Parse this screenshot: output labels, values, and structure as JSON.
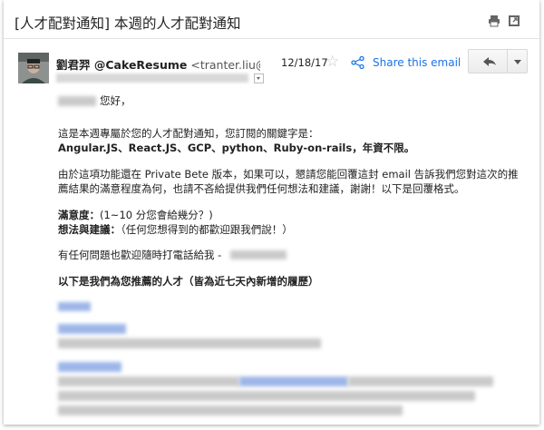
{
  "email": {
    "subject": "[人才配對通知] 本週的人才配對通知",
    "sender_name": "劉君羿 @CakeResume",
    "sender_email": "<tranter.liu@caker",
    "date": "12/18/17",
    "share_label": "Share this email"
  },
  "body": {
    "greeting": "您好，",
    "line1": "這是本週專屬於您的人才配對通知，您訂閱的關鍵字是：",
    "keywords": "Angular.JS、React.JS、GCP、python、Ruby-on-rails，年資不限。",
    "para2_line1": "由於這項功能還在 Private Bete 版本，如果可以，懇請您能回覆這封 email 告訴我們您對這次的推",
    "para2_line2": "薦結果的滿意程度為何，也請不吝給提供我們任何想法和建議，謝謝！以下是回覆格式。",
    "satisfaction_label": "滿意度：",
    "satisfaction_text": "(1~10 分您會給幾分？)",
    "feedback_label": "想法與建議：",
    "feedback_text": "（任何您想得到的都歡迎跟我們說！）",
    "contact_line": "有任何問題也歡迎隨時打電話給我 -",
    "recommend_heading": "以下是我們為您推薦的人才（皆為近七天內新增的履歷）"
  },
  "icons": {
    "print": "printer-icon",
    "popout": "new-window-icon",
    "star": "star-icon",
    "share": "share-icon",
    "reply": "reply-icon",
    "more": "chevron-down-icon"
  },
  "colors": {
    "link_blue": "#1a73e8",
    "text": "#222222"
  }
}
